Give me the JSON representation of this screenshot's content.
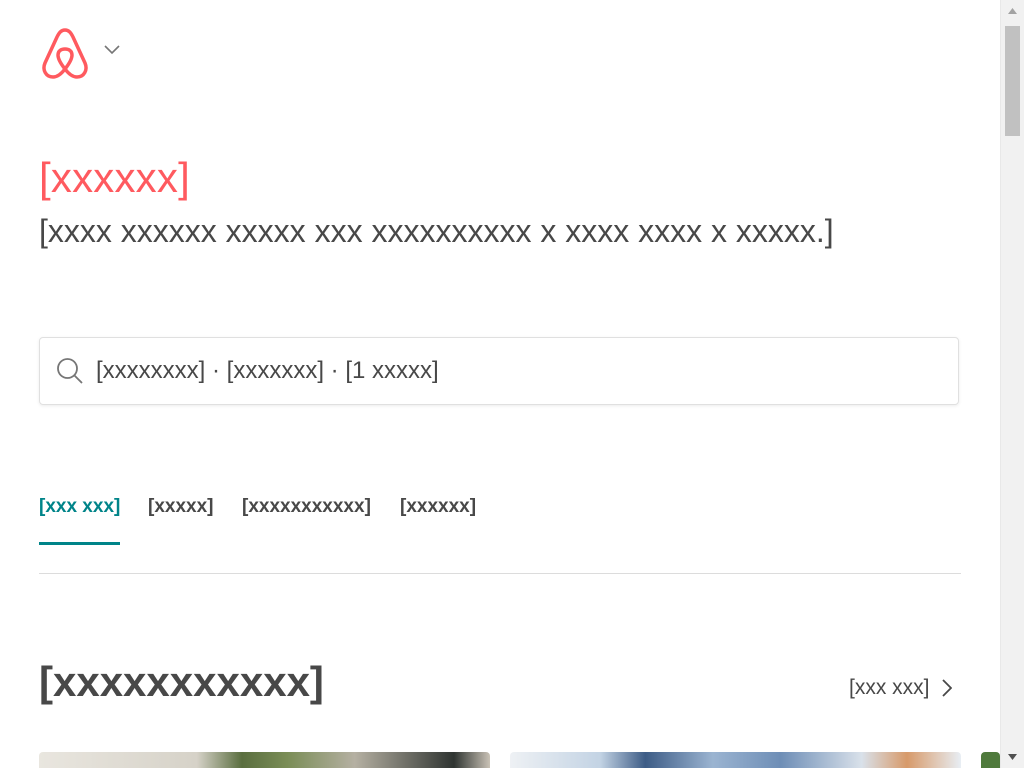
{
  "brand": {
    "title": "[xxxxxx]",
    "subtitle": "[xxxx xxxxxx xxxxx xxx xxxxxxxxxx x xxxx xxxx x xxxxx.]"
  },
  "search": {
    "text": "[xxxxxxxx] · [xxxxxxx] · [1 xxxxx]"
  },
  "tabs": [
    {
      "label": "[xxx xxx]",
      "active": true
    },
    {
      "label": "[xxxxx]",
      "active": false
    },
    {
      "label": "[xxxxxxxxxxx]",
      "active": false
    },
    {
      "label": "[xxxxxx]",
      "active": false
    }
  ],
  "section": {
    "title": "[xxxxxxxxxxx]",
    "see_all_label": "[xxx xxx]"
  },
  "colors": {
    "brand_accent": "#ff5a5f",
    "tab_active": "#008489",
    "text": "#484848"
  },
  "icons": [
    "airbnb-logo-icon",
    "chevron-down-icon",
    "search-icon",
    "chevron-right-icon",
    "scroll-up-arrow-icon",
    "scroll-down-arrow-icon"
  ]
}
